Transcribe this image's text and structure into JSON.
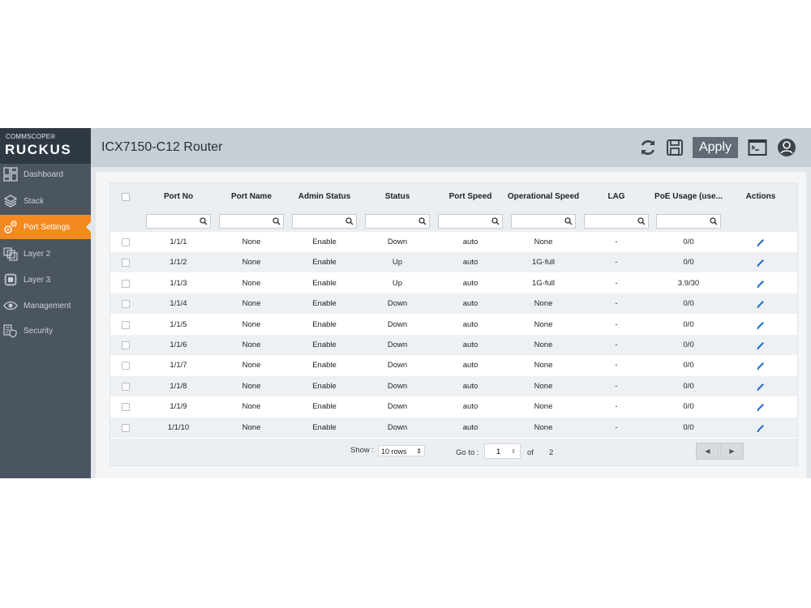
{
  "brand": {
    "company": "COMMSCOPE®",
    "product": "RUCKUS",
    "accent": "#f58a1f"
  },
  "sidebar": {
    "items": [
      {
        "label": "Dashboard",
        "icon": "dashboard-icon"
      },
      {
        "label": "Stack",
        "icon": "stack-layers-icon"
      },
      {
        "label": "Port Settings",
        "icon": "gears-icon",
        "active": true
      },
      {
        "label": "Layer 2",
        "icon": "layer2-icon"
      },
      {
        "label": "Layer 3",
        "icon": "layer3-chip-icon"
      },
      {
        "label": "Management",
        "icon": "eye-icon"
      },
      {
        "label": "Security",
        "icon": "security-shield-icon"
      }
    ]
  },
  "header": {
    "title": "ICX7150-C12 Router",
    "apply_label": "Apply",
    "icons": [
      "refresh-icon",
      "save-icon",
      "terminal-icon",
      "user-avatar-icon"
    ]
  },
  "table": {
    "columns": [
      "Port No",
      "Port Name",
      "Admin Status",
      "Status",
      "Port Speed",
      "Operational Speed",
      "LAG",
      "PoE Usage (use...",
      "Actions"
    ],
    "rows": [
      {
        "port_no": "1/1/1",
        "port_name": "None",
        "admin_status": "Enable",
        "status": "Down",
        "port_speed": "auto",
        "op_speed": "None",
        "lag": "-",
        "poe": "0/0"
      },
      {
        "port_no": "1/1/2",
        "port_name": "None",
        "admin_status": "Enable",
        "status": "Up",
        "port_speed": "auto",
        "op_speed": "1G-full",
        "lag": "-",
        "poe": "0/0"
      },
      {
        "port_no": "1/1/3",
        "port_name": "None",
        "admin_status": "Enable",
        "status": "Up",
        "port_speed": "auto",
        "op_speed": "1G-full",
        "lag": "-",
        "poe": "3.9/30"
      },
      {
        "port_no": "1/1/4",
        "port_name": "None",
        "admin_status": "Enable",
        "status": "Down",
        "port_speed": "auto",
        "op_speed": "None",
        "lag": "-",
        "poe": "0/0"
      },
      {
        "port_no": "1/1/5",
        "port_name": "None",
        "admin_status": "Enable",
        "status": "Down",
        "port_speed": "auto",
        "op_speed": "None",
        "lag": "-",
        "poe": "0/0"
      },
      {
        "port_no": "1/1/6",
        "port_name": "None",
        "admin_status": "Enable",
        "status": "Down",
        "port_speed": "auto",
        "op_speed": "None",
        "lag": "-",
        "poe": "0/0"
      },
      {
        "port_no": "1/1/7",
        "port_name": "None",
        "admin_status": "Enable",
        "status": "Down",
        "port_speed": "auto",
        "op_speed": "None",
        "lag": "-",
        "poe": "0/0"
      },
      {
        "port_no": "1/1/8",
        "port_name": "None",
        "admin_status": "Enable",
        "status": "Down",
        "port_speed": "auto",
        "op_speed": "None",
        "lag": "-",
        "poe": "0/0"
      },
      {
        "port_no": "1/1/9",
        "port_name": "None",
        "admin_status": "Enable",
        "status": "Down",
        "port_speed": "auto",
        "op_speed": "None",
        "lag": "-",
        "poe": "0/0"
      },
      {
        "port_no": "1/1/10",
        "port_name": "None",
        "admin_status": "Enable",
        "status": "Down",
        "port_speed": "auto",
        "op_speed": "None",
        "lag": "-",
        "poe": "0/0"
      }
    ]
  },
  "pagination": {
    "show_label": "Show :",
    "rows_option": "10 rows",
    "goto_label": "Go to :",
    "current_page": "1",
    "of_label": "of",
    "total_pages": "2"
  }
}
